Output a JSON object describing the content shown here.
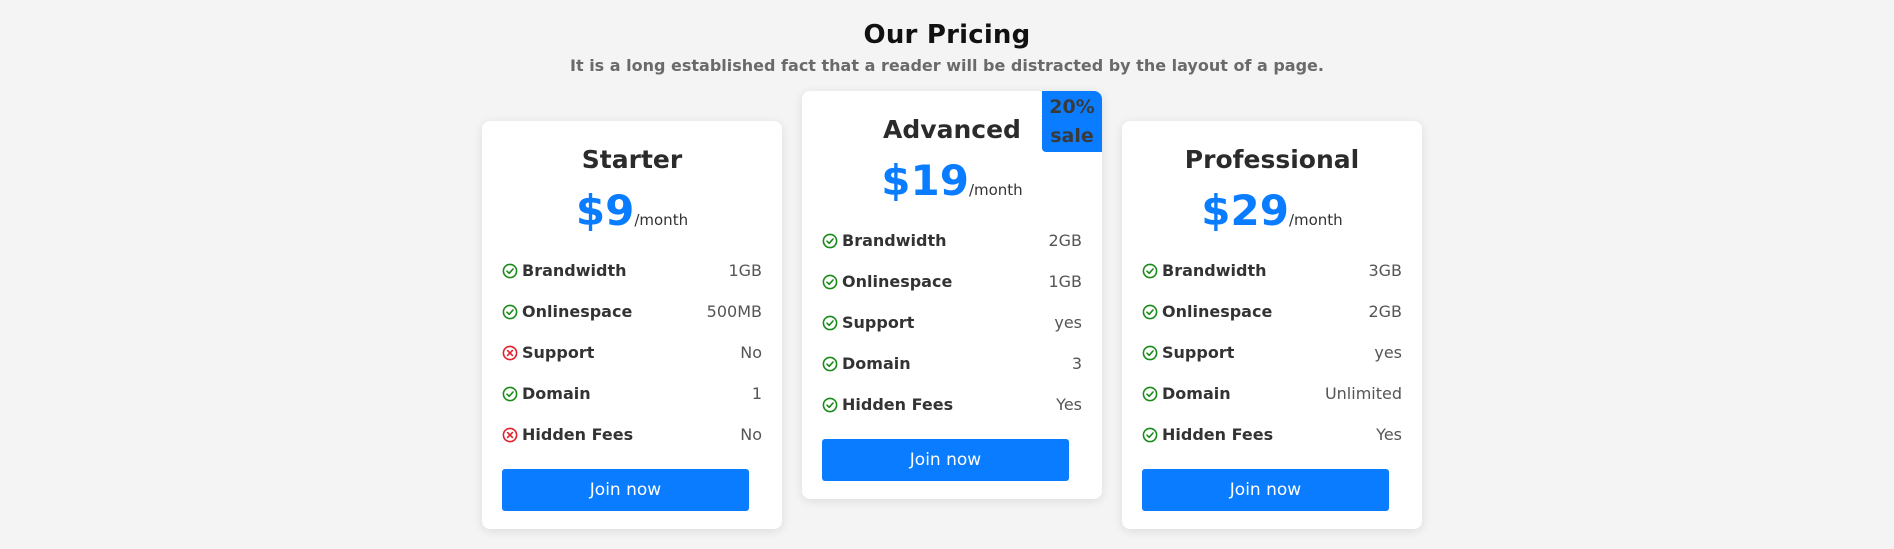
{
  "header": {
    "title": "Our Pricing",
    "subtitle": "It is a long established fact that a reader will be distracted by the layout of a page."
  },
  "colors": {
    "accent": "#0a7cff",
    "check": "#1a8a1a",
    "cross": "#e0202a",
    "background": "#f4f4f4"
  },
  "plans": [
    {
      "name": "Starter",
      "price": "$9",
      "period": "/month",
      "features": [
        {
          "label": "Brandwidth",
          "value": "1GB",
          "included": true
        },
        {
          "label": "Onlinespace",
          "value": "500MB",
          "included": true
        },
        {
          "label": "Support",
          "value": "No",
          "included": false
        },
        {
          "label": "Domain",
          "value": "1",
          "included": true
        },
        {
          "label": "Hidden Fees",
          "value": "No",
          "included": false
        }
      ],
      "button_label": "Join now"
    },
    {
      "name": "Advanced",
      "price": "$19",
      "period": "/month",
      "badge": {
        "line1": "20%",
        "line2": "sale"
      },
      "features": [
        {
          "label": "Brandwidth",
          "value": "2GB",
          "included": true
        },
        {
          "label": "Onlinespace",
          "value": "1GB",
          "included": true
        },
        {
          "label": "Support",
          "value": "yes",
          "included": true
        },
        {
          "label": "Domain",
          "value": "3",
          "included": true
        },
        {
          "label": "Hidden Fees",
          "value": "Yes",
          "included": true
        }
      ],
      "button_label": "Join now"
    },
    {
      "name": "Professional",
      "price": "$29",
      "period": "/month",
      "features": [
        {
          "label": "Brandwidth",
          "value": "3GB",
          "included": true
        },
        {
          "label": "Onlinespace",
          "value": "2GB",
          "included": true
        },
        {
          "label": "Support",
          "value": "yes",
          "included": true
        },
        {
          "label": "Domain",
          "value": "Unlimited",
          "included": true
        },
        {
          "label": "Hidden Fees",
          "value": "Yes",
          "included": true
        }
      ],
      "button_label": "Join now"
    }
  ],
  "icons": {
    "included": "check-circle-icon",
    "excluded": "x-circle-icon"
  }
}
